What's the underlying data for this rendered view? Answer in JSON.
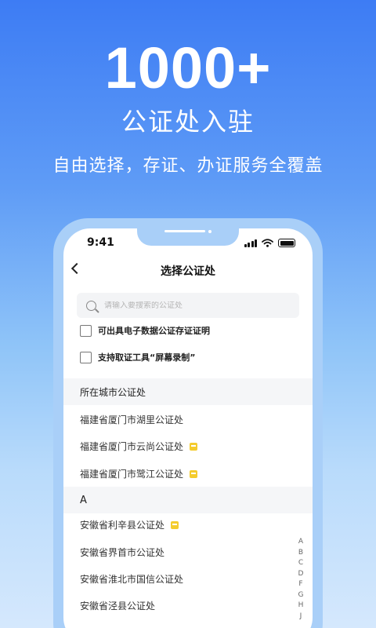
{
  "hero": {
    "number": "1000+",
    "title": "公证处入驻",
    "subtitle": "自由选择，存证、办证服务全覆盖"
  },
  "status_bar": {
    "time": "9:41"
  },
  "nav": {
    "title": "选择公证处"
  },
  "search": {
    "placeholder": "请输入要搜索的公证处"
  },
  "filters": [
    {
      "label": "可出具电子数据公证存证证明",
      "checked": false
    },
    {
      "label": "支持取证工具“屏幕录制”",
      "checked": false
    }
  ],
  "sections": {
    "city": {
      "header": "所在城市公证处",
      "items": [
        {
          "name": "福建省厦门市湖里公证处",
          "badge": false
        },
        {
          "name": "福建省厦门市云尚公证处",
          "badge": true
        },
        {
          "name": "福建省厦门市鹭江公证处",
          "badge": true
        }
      ]
    },
    "a": {
      "header": "A",
      "items": [
        {
          "name": "安徽省利辛县公证处",
          "badge": true
        },
        {
          "name": "安徽省界首市公证处",
          "badge": false
        },
        {
          "name": "安徽省淮北市国信公证处",
          "badge": false
        },
        {
          "name": "安徽省泾县公证处",
          "badge": false
        }
      ]
    }
  },
  "index_letters": [
    "A",
    "B",
    "C",
    "D",
    "F",
    "G",
    "H",
    "J"
  ],
  "colors": {
    "badge": "#f4cc2e",
    "frame": "#a9cff8",
    "background_top": "#3d7cf4"
  },
  "icons": [
    "back-arrow-icon",
    "search-icon",
    "signal-icon",
    "wifi-icon",
    "battery-icon",
    "badge-icon"
  ]
}
